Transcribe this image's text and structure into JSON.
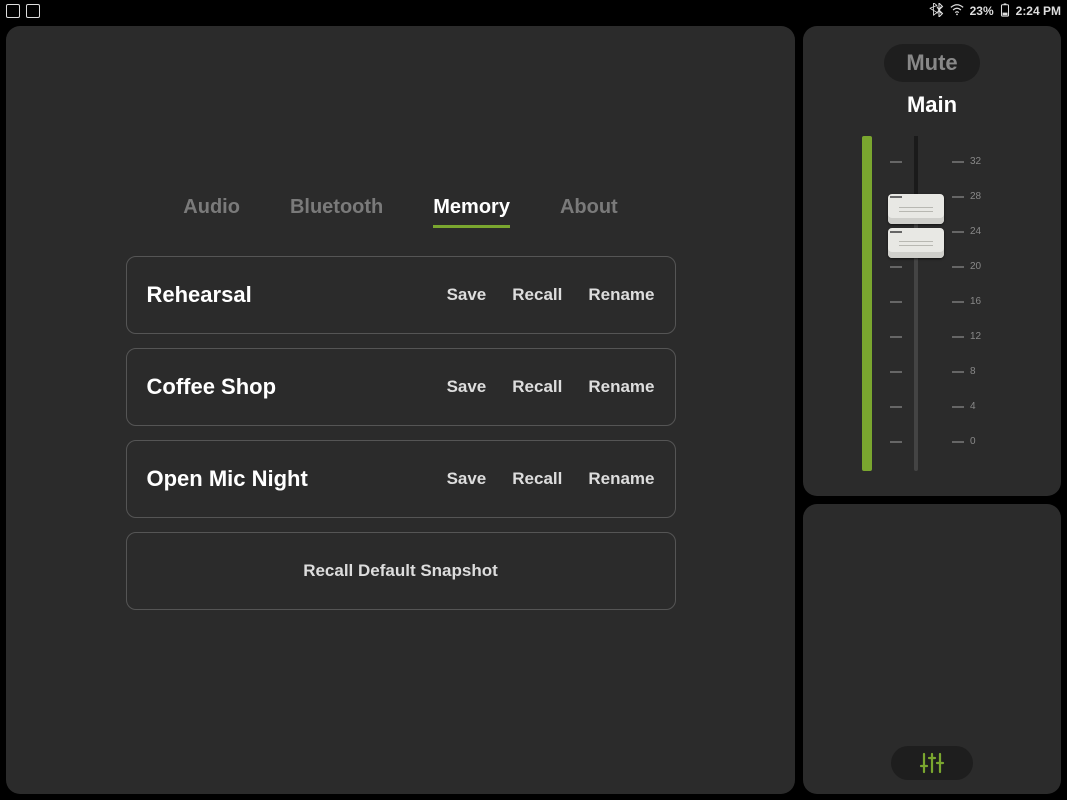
{
  "status": {
    "battery": "23%",
    "time": "2:24 PM"
  },
  "tabs": [
    {
      "label": "Audio",
      "active": false
    },
    {
      "label": "Bluetooth",
      "active": false
    },
    {
      "label": "Memory",
      "active": true
    },
    {
      "label": "About",
      "active": false
    }
  ],
  "memory": {
    "presets": [
      {
        "name": "Rehearsal",
        "save": "Save",
        "recall": "Recall",
        "rename": "Rename"
      },
      {
        "name": "Coffee Shop",
        "save": "Save",
        "recall": "Recall",
        "rename": "Rename"
      },
      {
        "name": "Open Mic Night",
        "save": "Save",
        "recall": "Recall",
        "rename": "Rename"
      }
    ],
    "default_label": "Recall Default Snapshot"
  },
  "mixer": {
    "mute_label": "Mute",
    "channel_label": "Main",
    "tick_values": [
      "32",
      "28",
      "24",
      "20",
      "16",
      "12",
      "8",
      "4",
      "0"
    ]
  }
}
